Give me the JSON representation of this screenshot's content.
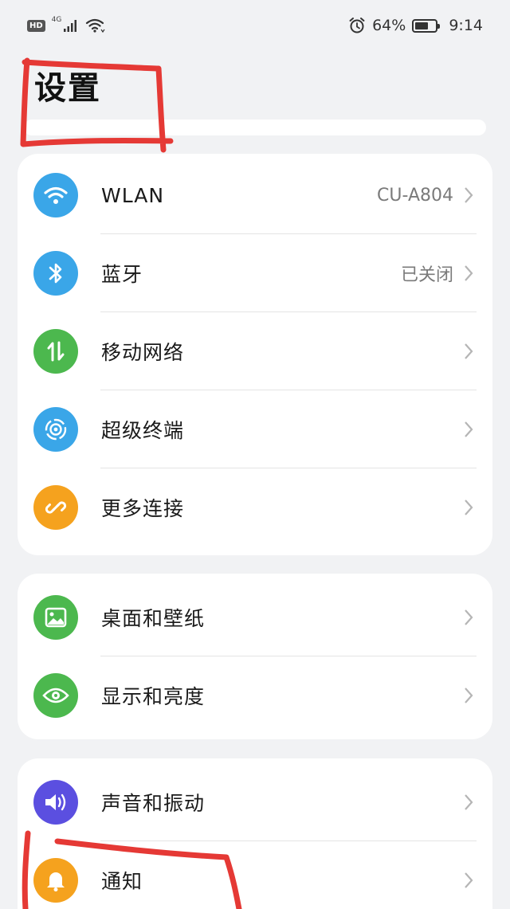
{
  "status_bar": {
    "hd": "HD",
    "network": "4G",
    "battery_percent": "64%",
    "battery_level": 0.64,
    "time": "9:14"
  },
  "page": {
    "title": "设置"
  },
  "groups": [
    {
      "items": [
        {
          "label": "WLAN",
          "value": "CU-A804",
          "icon": "wifi-icon",
          "color": "#3aa6e8"
        },
        {
          "label": "蓝牙",
          "value": "已关闭",
          "icon": "bluetooth-icon",
          "color": "#3aa6e8"
        },
        {
          "label": "移动网络",
          "value": "",
          "icon": "mobile-data-icon",
          "color": "#4cb84e"
        },
        {
          "label": "超级终端",
          "value": "",
          "icon": "super-device-icon",
          "color": "#3aa6e8"
        },
        {
          "label": "更多连接",
          "value": "",
          "icon": "link-icon",
          "color": "#f5a21e"
        }
      ]
    },
    {
      "items": [
        {
          "label": "桌面和壁纸",
          "value": "",
          "icon": "wallpaper-icon",
          "color": "#4cb84e"
        },
        {
          "label": "显示和亮度",
          "value": "",
          "icon": "eye-icon",
          "color": "#4cb84e"
        }
      ]
    },
    {
      "items": [
        {
          "label": "声音和振动",
          "value": "",
          "icon": "speaker-icon",
          "color": "#5b4fe0"
        },
        {
          "label": "通知",
          "value": "",
          "icon": "bell-icon",
          "color": "#f5a21e"
        }
      ]
    }
  ],
  "annotation_color": "#e53935"
}
